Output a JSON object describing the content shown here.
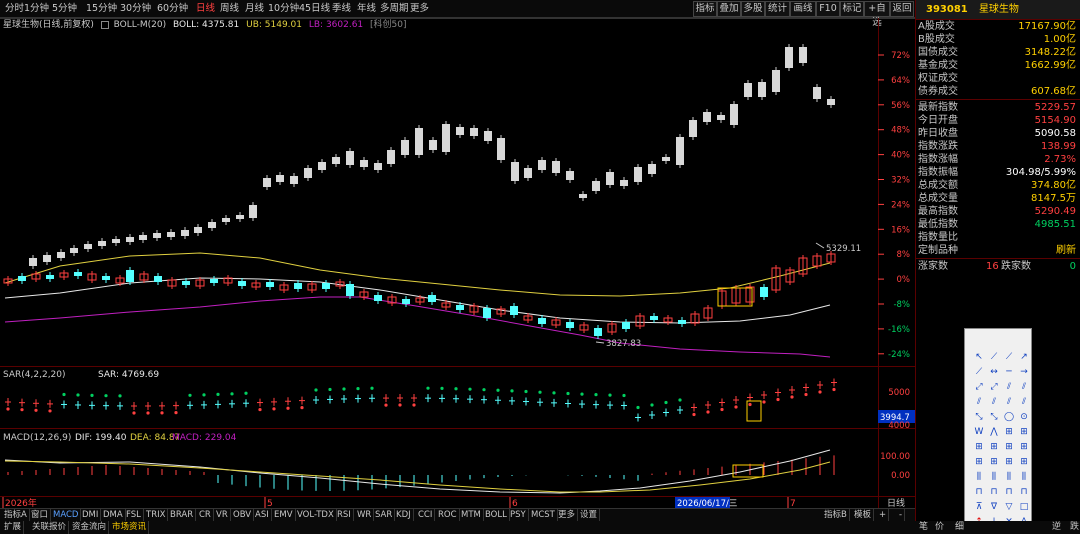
{
  "toolbar": {
    "periods": [
      "分时",
      "1分钟",
      "5分钟",
      "15分钟",
      "30分钟",
      "60分钟",
      "日线",
      "周线",
      "月线",
      "10分钟",
      "45日线",
      "季线",
      "年线",
      "多周期",
      "更多"
    ],
    "active_period": "日线",
    "buttons": [
      "指标",
      "叠加",
      "多股",
      "统计",
      "画线",
      "F10",
      "标记",
      "+自选",
      "返回"
    ]
  },
  "main_chart": {
    "title": "星球生物(日线,前复权)",
    "indicator": "BOLL-M(20)",
    "boll_label": "BOLL: 4375.81",
    "ub_label": "UB: 5149.01",
    "lb_label": "LB: 3602.61",
    "extra_label": "[科创50]",
    "high_annotation": "5329.11",
    "low_annotation": "3827.83",
    "y_ticks": [
      "72%",
      "64%",
      "56%",
      "48%",
      "40%",
      "32%",
      "24%",
      "16%",
      "8%",
      "0%",
      "-8%",
      "-16%",
      "-24%"
    ]
  },
  "sar_chart": {
    "label": "SAR(4,2,2,20)",
    "value_label": "SAR: 4769.69",
    "y_tick": "5000",
    "current_value": "3994.7",
    "low_tick": "4000"
  },
  "macd_chart": {
    "label": "MACD(12,26,9)",
    "dif_label": "DIF: 199.40",
    "dea_label": "DEA: 84.87",
    "macd_label": "MACD: 229.04",
    "y_ticks": [
      "100.00",
      "0.00"
    ]
  },
  "x_axis": {
    "labels": [
      "2026年",
      "5",
      "6",
      "7"
    ],
    "highlight_date": "2026/06/17/三",
    "period_label": "日线"
  },
  "indicator_tabs": [
    "指标A",
    "窗口",
    "MACD",
    "DMI",
    "DMA",
    "FSL",
    "TRIX",
    "BRAR",
    "CR",
    "VR",
    "OBV",
    "ASI",
    "EMV",
    "VOL-TDX",
    "RSI",
    "WR",
    "SAR",
    "KDJ",
    "CCI",
    "ROC",
    "MTM",
    "BOLL",
    "PSY",
    "MCST",
    "更多",
    "设置"
  ],
  "active_indicator_tab": "MACD",
  "indicator_right": [
    "指标B",
    "模板",
    "+",
    "-"
  ],
  "bottom_tabs": [
    "扩展",
    "关联报价",
    "资金流向",
    "市场资讯"
  ],
  "active_bottom_tab": "市场资讯",
  "panel": {
    "code": "393081",
    "name": "星球生物",
    "turnover": [
      {
        "label": "A股成交",
        "value": "17167.90亿"
      },
      {
        "label": "B股成交",
        "value": "1.00亿"
      },
      {
        "label": "国债成交",
        "value": "3148.22亿"
      },
      {
        "label": "基金成交",
        "value": "1662.99亿"
      },
      {
        "label": "权证成交",
        "value": ""
      },
      {
        "label": "债券成交",
        "value": "607.68亿"
      }
    ],
    "index_stats": [
      {
        "label": "最新指数",
        "value": "5229.57",
        "color": "r"
      },
      {
        "label": "今日开盘",
        "value": "5154.90",
        "color": "r"
      },
      {
        "label": "昨日收盘",
        "value": "5090.58",
        "color": "w"
      },
      {
        "label": "指数涨跌",
        "value": "138.99",
        "color": "r"
      },
      {
        "label": "指数涨幅",
        "value": "2.73%",
        "color": "r"
      },
      {
        "label": "指数振幅",
        "value": "304.98/5.99%",
        "color": "w"
      },
      {
        "label": "总成交额",
        "value": "374.80亿",
        "color": "y"
      },
      {
        "label": "总成交量",
        "value": "8147.5万",
        "color": "y"
      },
      {
        "label": "最高指数",
        "value": "5290.49",
        "color": "r"
      },
      {
        "label": "最低指数",
        "value": "4985.51",
        "color": "g"
      },
      {
        "label": "指数量比",
        "value": "",
        "color": "w"
      },
      {
        "label": "定制品种",
        "value": "刷新",
        "color": "y"
      }
    ],
    "breadth": {
      "up_label": "涨家数",
      "up_value": "16",
      "down_label": "跌家数",
      "down_value": "0"
    },
    "bottom": [
      "笔",
      "价",
      "细",
      "逆",
      "跌"
    ]
  },
  "colors": {
    "up": "#ff4040",
    "down": "#54ffff",
    "ma_yellow": "#e0d040",
    "ma_white": "#e8e8e8",
    "ma_purple": "#c020c0",
    "grid_red": "#5a0000"
  }
}
